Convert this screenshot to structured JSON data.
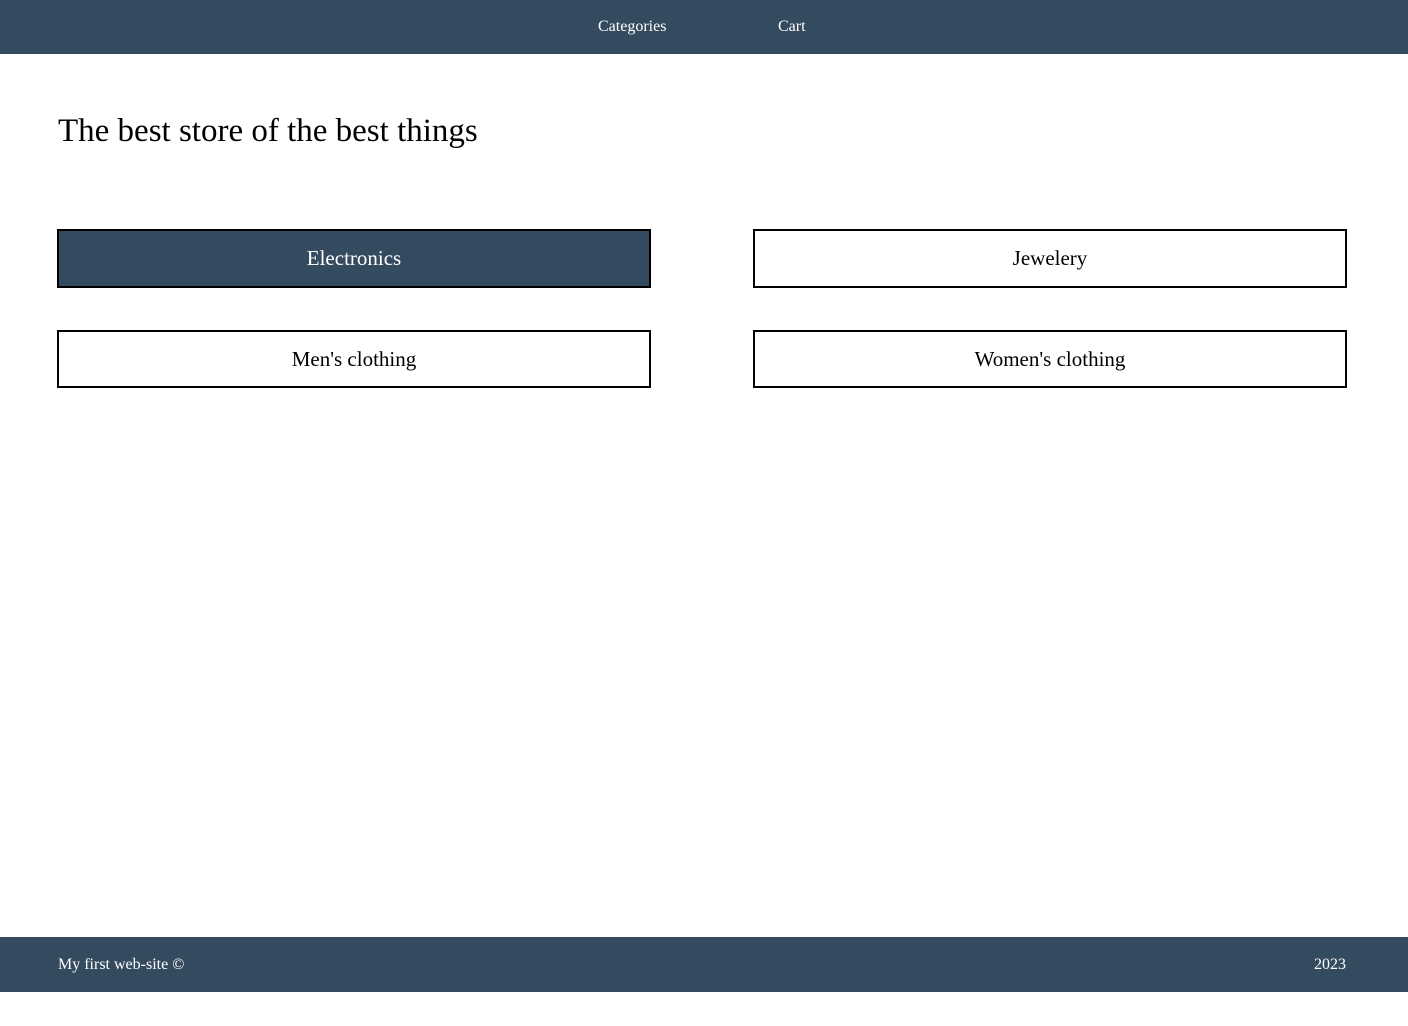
{
  "nav": {
    "categories_label": "Categories",
    "cart_label": "Cart"
  },
  "main": {
    "title": "The best store of the best things",
    "categories": [
      {
        "label": "Electronics",
        "active": true
      },
      {
        "label": "Jewelery",
        "active": false
      },
      {
        "label": "Men's clothing",
        "active": false
      },
      {
        "label": "Women's clothing",
        "active": false
      }
    ]
  },
  "footer": {
    "left_text": "My first web-site ©",
    "year": "2023"
  },
  "colors": {
    "brand": "#344a5f",
    "background": "#ffffff"
  }
}
